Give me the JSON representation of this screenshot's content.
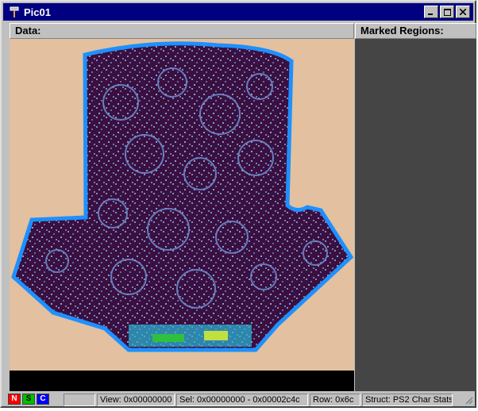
{
  "window": {
    "title": "Pic01",
    "icons": {
      "app": "hammer-icon",
      "minimize": "minimize-icon",
      "maximize": "maximize-icon",
      "close": "close-icon"
    }
  },
  "panes": {
    "data_label": "Data:",
    "marked_label": "Marked Regions:"
  },
  "status": {
    "mode_icons": [
      {
        "name": "n-mode-icon",
        "glyph": "N",
        "color": "#ff0000"
      },
      {
        "name": "s-mode-icon",
        "glyph": "S",
        "color": "#00c000"
      },
      {
        "name": "c-mode-icon",
        "glyph": "C",
        "color": "#0000ff"
      }
    ],
    "view": "View: 0x00000000",
    "sel": "Sel: 0x00000000 - 0x00002c4c",
    "row": "Row: 0x6c",
    "struct": "Struct: PS2 Char Stats"
  },
  "colors": {
    "titlebar": "#000080",
    "background": "#e2c0a0",
    "shape_fill": "#3b0f3f",
    "shape_edge": "#1e90ff",
    "marked_panel": "#454545"
  }
}
